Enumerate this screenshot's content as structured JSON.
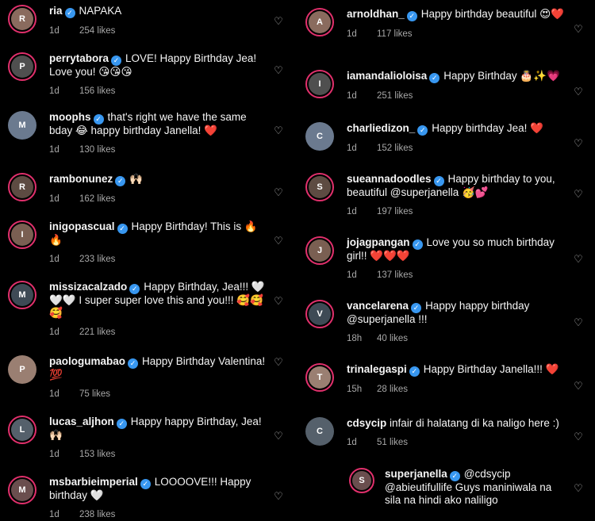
{
  "verified_glyph": "✓",
  "heart_glyph": "♡",
  "likes_suffix": "likes",
  "left": [
    {
      "username": "ria",
      "verified": true,
      "text": "NAPAKA",
      "time": "1d",
      "likes": "254",
      "initial": "R",
      "ring": true
    },
    {
      "username": "perrytabora",
      "verified": true,
      "text": "LOVE! Happy Birthday Jea! Love you! 😘😘😘",
      "time": "1d",
      "likes": "156",
      "initial": "P",
      "ring": true
    },
    {
      "username": "moophs",
      "verified": true,
      "text": "that's right we have the same bday 😂 happy birthday Janella! ❤️",
      "time": "1d",
      "likes": "130",
      "initial": "M",
      "ring": false
    },
    {
      "username": "rambonunez",
      "verified": true,
      "text": "🙌🏻",
      "time": "1d",
      "likes": "162",
      "initial": "R",
      "ring": true
    },
    {
      "username": "inigopascual",
      "verified": true,
      "text": "Happy Birthday! This is 🔥🔥",
      "time": "1d",
      "likes": "233",
      "initial": "I",
      "ring": true
    },
    {
      "username": "missizacalzado",
      "verified": true,
      "text": "Happy Birthday, Jea!!! 🤍🤍🤍 I super super love this and you!!! 🥰🥰🥰",
      "time": "1d",
      "likes": "221",
      "initial": "M",
      "ring": true
    },
    {
      "username": "paologumabao",
      "verified": true,
      "text": "Happy Birthday Valentina! 💯",
      "time": "1d",
      "likes": "75",
      "initial": "P",
      "ring": false
    },
    {
      "username": "lucas_aljhon",
      "verified": true,
      "text": "Happy happy Birthday, Jea! 🙌🏻",
      "time": "1d",
      "likes": "153",
      "initial": "L",
      "ring": true
    },
    {
      "username": "msbarbieimperial",
      "verified": true,
      "text": "LOOOOVE!!! Happy birthday 🤍",
      "time": "1d",
      "likes": "238",
      "initial": "M",
      "ring": true
    }
  ],
  "right": [
    {
      "username": "arnoldhan_",
      "verified": true,
      "text": "Happy birthday beautiful 😍❤️",
      "time": "1d",
      "likes": "117",
      "initial": "A",
      "ring": true
    },
    {
      "username": "iamandalioloisa",
      "verified": true,
      "text": "Happy Birthday 🎂✨💗",
      "time": "1d",
      "likes": "251",
      "initial": "I",
      "ring": true
    },
    {
      "username": "charliedizon_",
      "verified": true,
      "text": "Happy birthday Jea! ❤️",
      "time": "1d",
      "likes": "152",
      "initial": "C",
      "ring": false
    },
    {
      "username": "sueannadoodles",
      "verified": true,
      "text": "Happy birthday to you, beautiful @superjanella 🥳💕",
      "time": "1d",
      "likes": "197",
      "initial": "S",
      "ring": true
    },
    {
      "username": "jojagpangan",
      "verified": true,
      "text": "Love you so much birthday girl!! ❤️❤️❤️",
      "time": "1d",
      "likes": "137",
      "initial": "J",
      "ring": true
    },
    {
      "username": "vancelarena",
      "verified": true,
      "text": "Happy happy birthday @superjanella !!!",
      "time": "18h",
      "likes": "40",
      "initial": "V",
      "ring": true
    },
    {
      "username": "trinalegaspi",
      "verified": true,
      "text": "Happy Birthday Janella!!! ❤️",
      "time": "15h",
      "likes": "28",
      "initial": "T",
      "ring": true
    },
    {
      "username": "cdsycip",
      "verified": false,
      "text": "infair di halatang di ka naligo here :)",
      "time": "1d",
      "likes": "51",
      "initial": "C",
      "ring": false
    },
    {
      "username": "superjanella",
      "verified": true,
      "text": "@cdsycip @abieutifullife Guys maniniwala na sila na hindi ako naliligo",
      "time": "",
      "likes": "",
      "initial": "S",
      "ring": true,
      "reply": true
    }
  ]
}
